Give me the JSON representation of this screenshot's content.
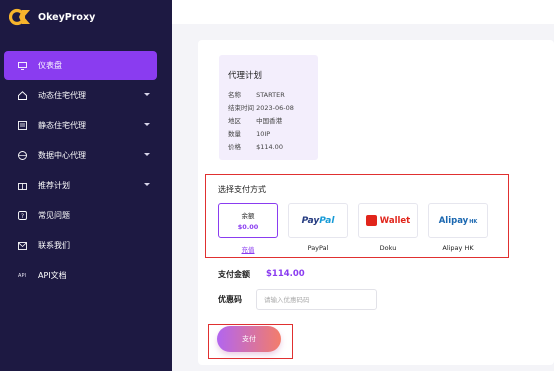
{
  "brand": {
    "name": "OkeyProxy",
    "logo_mark": "OK",
    "accent": "#8a3cf0"
  },
  "sidebar": {
    "items": [
      {
        "label": "仪表盘",
        "icon": "monitor-icon",
        "active": true,
        "has_chevron": false
      },
      {
        "label": "动态住宅代理",
        "icon": "home-icon",
        "active": false,
        "has_chevron": true
      },
      {
        "label": "静态住宅代理",
        "icon": "list-icon",
        "active": false,
        "has_chevron": true
      },
      {
        "label": "数据中心代理",
        "icon": "globe-icon",
        "active": false,
        "has_chevron": true
      },
      {
        "label": "推荐计划",
        "icon": "gift-icon",
        "active": false,
        "has_chevron": true
      },
      {
        "label": "常见问题",
        "icon": "question-icon",
        "active": false,
        "has_chevron": false
      },
      {
        "label": "联系我们",
        "icon": "mail-icon",
        "active": false,
        "has_chevron": false
      },
      {
        "label": "API文档",
        "icon": "api-icon",
        "active": false,
        "has_chevron": false
      }
    ]
  },
  "plan": {
    "title": "代理计划",
    "rows": [
      {
        "key": "名称",
        "value": "STARTER"
      },
      {
        "key": "结束时间",
        "value": "2023-06-08"
      },
      {
        "key": "地区",
        "value": "中国香港"
      },
      {
        "key": "数量",
        "value": "10IP"
      },
      {
        "key": "价格",
        "value": "$114.00"
      }
    ]
  },
  "payment": {
    "title": "选择支付方式",
    "methods": [
      {
        "id": "balance",
        "line1": "余额",
        "line2": "$0.00",
        "caption": "充值",
        "selected": true
      },
      {
        "id": "paypal",
        "caption": "PayPal",
        "logo_text_a": "Pay",
        "logo_text_b": "Pal"
      },
      {
        "id": "doku",
        "caption": "Doku",
        "logo_text": "Wallet"
      },
      {
        "id": "alipay",
        "caption": "Alipay HK",
        "logo_text": "Alipay",
        "logo_sub": "HK"
      }
    ]
  },
  "amount": {
    "label": "支付金额",
    "value": "$114.00"
  },
  "coupon": {
    "label": "优惠码",
    "placeholder": "请输入优惠码码"
  },
  "pay_button": {
    "label": "支付"
  }
}
